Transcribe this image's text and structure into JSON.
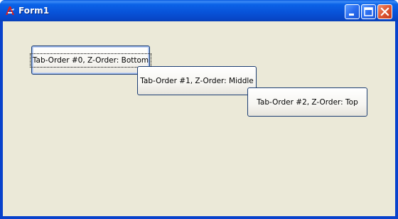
{
  "window": {
    "title": "Form1"
  },
  "title_buttons": {
    "minimize_icon": "minimize-icon",
    "maximize_icon": "maximize-icon",
    "close_icon": "close-icon"
  },
  "buttons": [
    {
      "label": "Tab-Order #0, Z-Order: Bottom"
    },
    {
      "label": "Tab-Order #1, Z-Order: Middle"
    },
    {
      "label": "Tab-Order #2, Z-Order: Top"
    }
  ],
  "colors": {
    "titlebar": "#0b63e8",
    "client_background": "#ebe9d8",
    "close_button": "#e05a36"
  }
}
